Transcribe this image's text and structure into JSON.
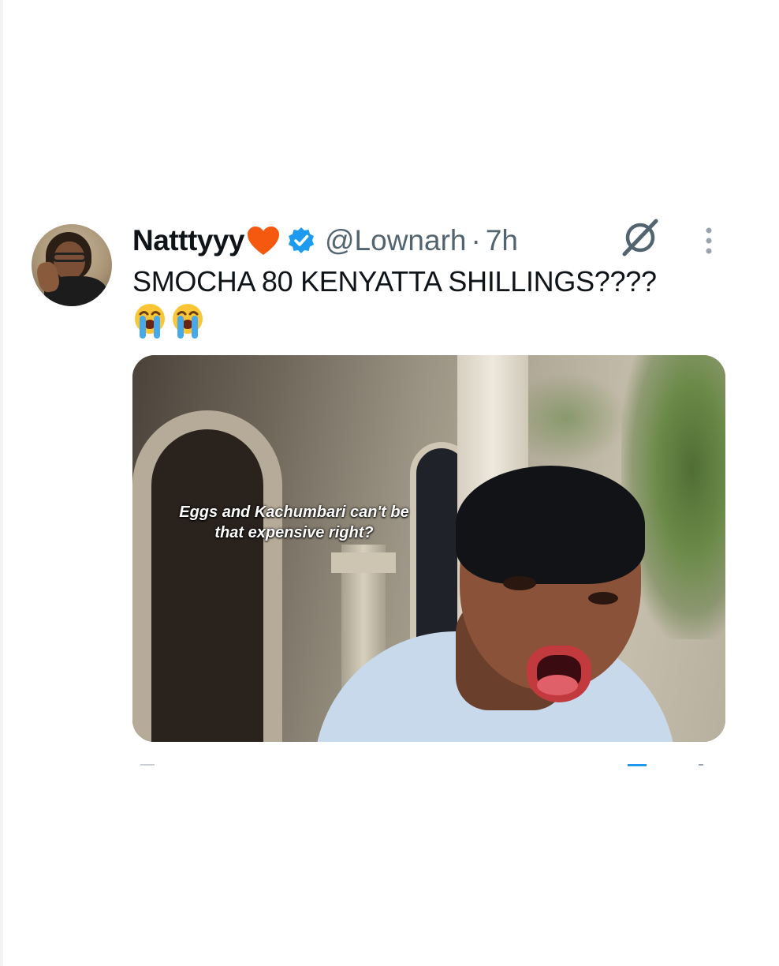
{
  "tweet": {
    "display_name": "Natttyyy",
    "handle": "@Lownarh",
    "separator": "·",
    "time": "7h",
    "text": "SMOCHA 80 KENYATTA SHILLINGS????",
    "emojis": [
      "loudly-crying-face",
      "loudly-crying-face"
    ],
    "media_caption": "Eggs and Kachumbari can't be that expensive right?"
  },
  "icons": {
    "name_emoji": "orange-heart",
    "verified": "verified-badge",
    "grok": "grok-icon",
    "more": "more-options-icon"
  },
  "colors": {
    "text_primary": "#0f1419",
    "text_secondary": "#536471",
    "accent_blue": "#1d9bf0",
    "heart_orange": "#f4590f"
  }
}
